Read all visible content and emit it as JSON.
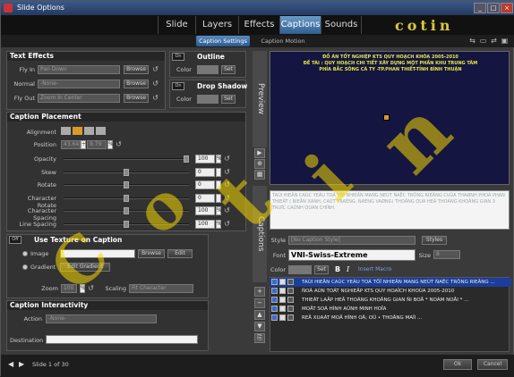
{
  "window": {
    "title": "Slide Options"
  },
  "tabs": [
    "Slide",
    "Layers",
    "Effects",
    "Captions",
    "Sounds"
  ],
  "active_tab": "Captions",
  "logo_text": "cotin",
  "subtabs": [
    "Caption Settings",
    "Caption Motion"
  ],
  "text_effects": {
    "title": "Text Effects",
    "fly_in_label": "Fly In",
    "fly_in_value": "Pan Down",
    "normal_label": "Normal",
    "normal_value": "-None-",
    "fly_out_label": "Fly Out",
    "fly_out_value": "Zoom In Center",
    "browse": "Browse"
  },
  "outline": {
    "on": "On",
    "title": "Outline",
    "color_label": "Color",
    "set": "Set"
  },
  "drop_shadow": {
    "on": "On",
    "title": "Drop Shadow",
    "color_label": "Color",
    "set": "Set"
  },
  "placement": {
    "title": "Caption Placement",
    "alignment_label": "Alignment",
    "position_label": "Position",
    "pos_x": "43.64",
    "pos_y": "9.79",
    "pos_unit": "%",
    "rows": [
      {
        "label": "Opacity",
        "value": "100",
        "unit": "%",
        "level": 1.0
      },
      {
        "label": "Skew",
        "value": "0",
        "unit": "",
        "level": 0.5
      },
      {
        "label": "Rotate",
        "value": "0",
        "unit": "",
        "level": 0.5
      },
      {
        "label": "Character Rotate",
        "value": "0",
        "unit": "",
        "level": 0.5
      },
      {
        "label": "Character Spacing",
        "value": "100",
        "unit": "%",
        "level": 0.5
      },
      {
        "label": "Line Spacing",
        "value": "100",
        "unit": "%",
        "level": 0.5
      }
    ]
  },
  "texture": {
    "off": "Off",
    "title": "Use Texture on Caption",
    "image_label": "Image",
    "gradient_label": "Gradient",
    "browse": "Browse",
    "edit": "Edit",
    "edit_gradient": "Edit Gradient",
    "zoom_label": "Zoom",
    "zoom_value": "100",
    "zoom_unit": "%",
    "scaling_label": "Scaling",
    "scaling_value": "Fit Character"
  },
  "interactivity": {
    "title": "Caption Interactivity",
    "action_label": "Action",
    "action_value": "-None-",
    "destination_label": "Destination"
  },
  "side_tabs": {
    "preview": "Preview",
    "captions": "Captions"
  },
  "preview": {
    "line1": "ĐỒ ÁN TỐT NGHIỆP KTS QUY HOẠCH KHÓA 2005-2010",
    "line2": "ĐỀ TÀI : QUY HOẠCH CHI TIẾT XÂY DỰNG MỘT PHẦN KHU TRUNG TÂM",
    "line3": "PHÍA BẮC SÔNG CÀ TY -TP.PHAN THIẾT-TỈNH BÌNH THUẬN"
  },
  "caption_text": "TAÙI HIEÄN CAÙC YEÁU TOÁ TÖÏ NHIEÂN MANG NEÙT ÑAËC TRÖNG RIEÂNG CUÛA THAØNH PHOÁ PHAN THIEÁT ( BIEÅN XANH, CAÙT TRAÉNG, NAÉNG VAØNG) THOÂNG QUA HEÄ THOÁNG KHOÂNG GIAN 3 TRUÏC CAÛNH QUAN CHÍNH.",
  "style": {
    "style_label": "Style",
    "style_value": "[No Caption Style]",
    "styles_btn": "Styles",
    "font_label": "Font",
    "font_value": "VNI-Swiss-Extreme",
    "size_label": "Size",
    "size_value": "8",
    "color_label": "Color",
    "set": "Set",
    "bold": "B",
    "italic": "I",
    "insert_macro": "Insert Macro"
  },
  "caption_list": [
    "TAÙI HIEÄN CAÙC YEÁU TOÁ TÖÏ NHIEÂN MANG NEÙT ÑAËC TRÖNG RIEÂNG ...",
    "ÑOÀ AÙN TOÁT NGHIEÄP KTS QUY HOAÏCH KHOÙA 2005-2010",
    "THIEÁT LAÄP HEÄ THOÁNG KHOÂNG GIAN ÑI BOÄ  * NOÀM NOÅI * ...",
    "MOÄT SOÁ HÌNH AÛNH MINH HOÏA",
    "REÅ XUAÁT MOÄ HÌNH OÂ; OÛ • THOÂNG MAÏI ..."
  ],
  "footer": {
    "slide_label": "Slide 1 of 30",
    "ok": "Ok",
    "cancel": "Cancel"
  },
  "colors": {
    "accent": "#2f5f90",
    "selection": "#1c3e9a",
    "preview_bg": "#141540",
    "preview_text": "#e8e840",
    "watermark": "#f5d700"
  }
}
